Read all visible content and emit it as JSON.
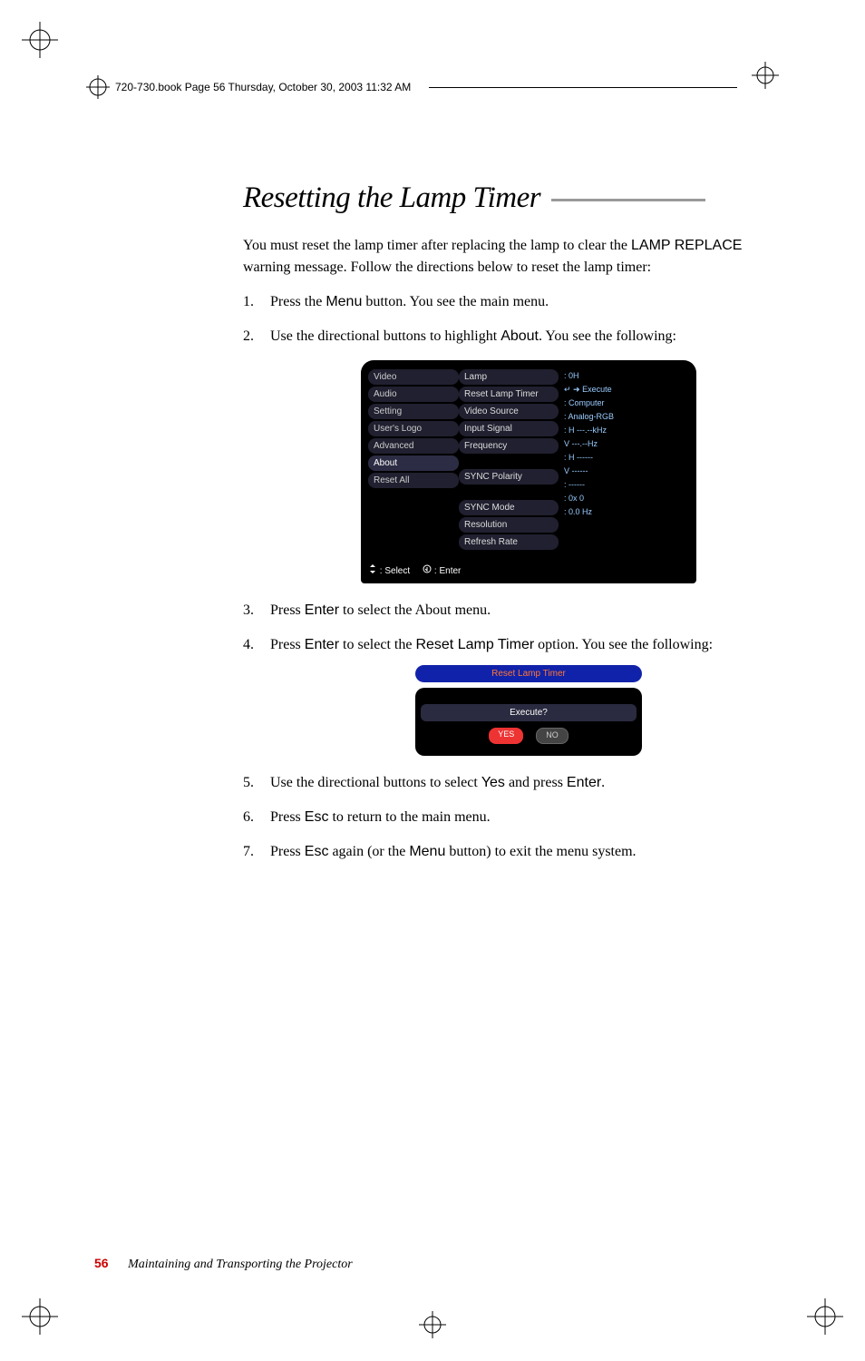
{
  "header": {
    "text": "720-730.book  Page 56  Thursday, October 30, 2003  11:32 AM"
  },
  "title": "Resetting the Lamp Timer",
  "intro": {
    "p1a": "You must reset the lamp timer after replacing the lamp to clear the ",
    "p1sans": "LAMP REPLACE",
    "p1b": " warning message. Follow the directions below to reset the lamp timer:"
  },
  "steps": {
    "s1a": "Press the ",
    "s1sans": "Menu",
    "s1b": " button. You see the main menu.",
    "s2a": "Use the directional buttons to highlight ",
    "s2sans": "About",
    "s2b": ". You see the following:",
    "s3a": "Press ",
    "s3sans": "Enter",
    "s3b": " to select the About menu.",
    "s4a": "Press ",
    "s4sans1": "Enter",
    "s4b": " to select the ",
    "s4sans2": "Reset Lamp Timer",
    "s4c": " option. You see the following:",
    "s5a": "Use the directional buttons to select ",
    "s5sans1": "Yes",
    "s5b": " and press ",
    "s5sans2": "Enter",
    "s5c": ".",
    "s6a": "Press ",
    "s6sans": "Esc",
    "s6b": " to return to the main menu.",
    "s7a": "Press ",
    "s7sans1": "Esc",
    "s7b": " again (or the ",
    "s7sans2": "Menu",
    "s7c": " button) to exit the menu system."
  },
  "osd": {
    "left_items": [
      "Video",
      "Audio",
      "Setting",
      "User's Logo",
      "Advanced",
      "About",
      "Reset All"
    ],
    "mid_items": [
      "Lamp",
      "Reset Lamp Timer",
      "Video Source",
      "Input Signal",
      "Frequency",
      "",
      "SYNC Polarity",
      "",
      "SYNC Mode",
      "Resolution",
      "Refresh Rate"
    ],
    "right_values": [
      ": 0H",
      "↵ ➜ Execute",
      ": Computer",
      ": Analog-RGB",
      ": H ---.--kHz",
      "  V ---.--Hz",
      ": H ------",
      "  V ------",
      ": ------",
      ": 0x    0",
      ": 0.0 Hz"
    ],
    "footer_select": "  : Select",
    "footer_enter": " : Enter"
  },
  "reset_dialog": {
    "title": "Reset Lamp Timer",
    "question": "Execute?",
    "yes": "YES",
    "no": "NO"
  },
  "footer": {
    "page": "56",
    "chapter": "Maintaining and Transporting the Projector"
  }
}
